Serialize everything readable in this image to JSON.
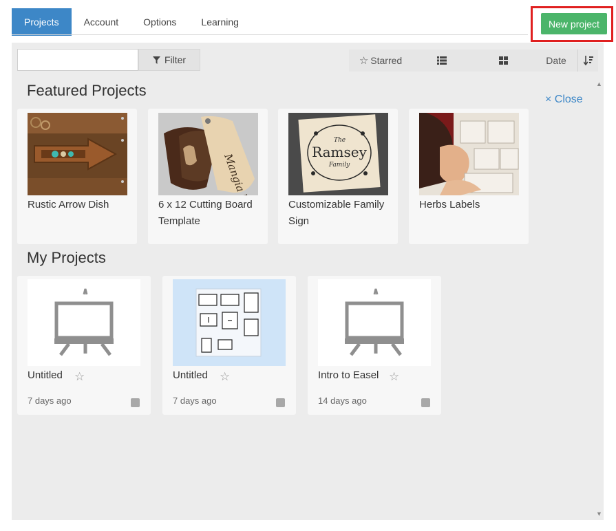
{
  "tabs": [
    {
      "label": "Projects",
      "active": true
    },
    {
      "label": "Account",
      "active": false
    },
    {
      "label": "Options",
      "active": false
    },
    {
      "label": "Learning",
      "active": false
    }
  ],
  "new_project_label": "New project",
  "search": {
    "placeholder": "",
    "value": ""
  },
  "toolbar": {
    "filter_label": "Filter",
    "starred_label": "Starred",
    "sort_label": "Date"
  },
  "featured": {
    "title": "Featured Projects",
    "close_label": "× Close",
    "items": [
      {
        "name": "Rustic Arrow Dish"
      },
      {
        "name": "6 x 12 Cutting Board Template"
      },
      {
        "name": "Customizable Family Sign"
      },
      {
        "name": "Herbs Labels"
      }
    ]
  },
  "my_projects": {
    "title": "My Projects",
    "items": [
      {
        "name": "Untitled",
        "date": "7 days ago"
      },
      {
        "name": "Untitled",
        "date": "7 days ago"
      },
      {
        "name": "Intro to Easel",
        "date": "14 days ago"
      }
    ]
  },
  "thumb_text": {
    "board": "Mangia bene",
    "sign_main": "Ramsey",
    "sign_sub": "The",
    "sign_sub2": "Family"
  },
  "colors": {
    "accent": "#3d87c7",
    "new_project_bg": "#4bb56a",
    "highlight": "#e02020",
    "panel_bg": "#ececec"
  }
}
